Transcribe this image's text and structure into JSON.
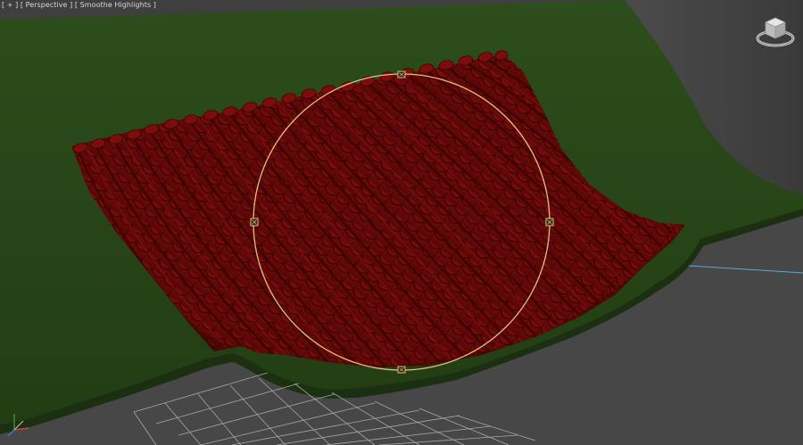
{
  "viewport": {
    "label_plus": "[ + ]",
    "label_view": "[ Perspective ]",
    "label_shading": "[ Smoothe Highlights ]"
  },
  "colors": {
    "background": "#3f3f3f",
    "ground": "#4a4a4a",
    "terrain": "#29481a",
    "terrain_dark": "#20380f",
    "fabric": "#6e0b0b",
    "fabric_shade": "#4a0606",
    "selection_circle": "#e0c084",
    "grid": "#b8b8b8",
    "horizon_line": "#5da8d6"
  },
  "icons": {
    "viewcube": "viewcube-icon",
    "axis": "axis-tripod-icon",
    "handle": "gizmo-handle-icon"
  }
}
